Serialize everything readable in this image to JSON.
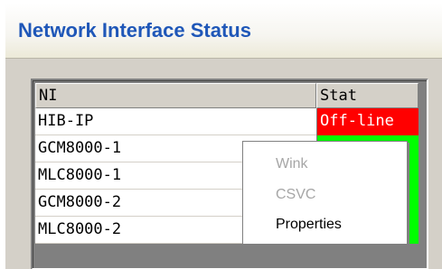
{
  "window": {
    "title": "Network Interface Status"
  },
  "table": {
    "columns": [
      "NI",
      "Stat"
    ],
    "rows": [
      {
        "ni": "HIB-IP",
        "stat": "Off-line",
        "status_color": "#ff0000"
      },
      {
        "ni": "GCM8000-1",
        "stat": "",
        "status_color": "#00ff00"
      },
      {
        "ni": "MLC8000-1",
        "stat": "",
        "status_color": "#00ff00"
      },
      {
        "ni": "GCM8000-2",
        "stat": "",
        "status_color": "#00ff00"
      },
      {
        "ni": "MLC8000-2",
        "stat": "",
        "status_color": "#00ff00"
      }
    ]
  },
  "context_menu": {
    "items": [
      {
        "label": "Wink",
        "enabled": false
      },
      {
        "label": "CSVC",
        "enabled": false
      },
      {
        "label": "Properties",
        "enabled": true
      }
    ]
  },
  "colors": {
    "title": "#1f57b8",
    "offline": "#ff0000",
    "online": "#00ff00",
    "panel": "#d4d0c8"
  }
}
